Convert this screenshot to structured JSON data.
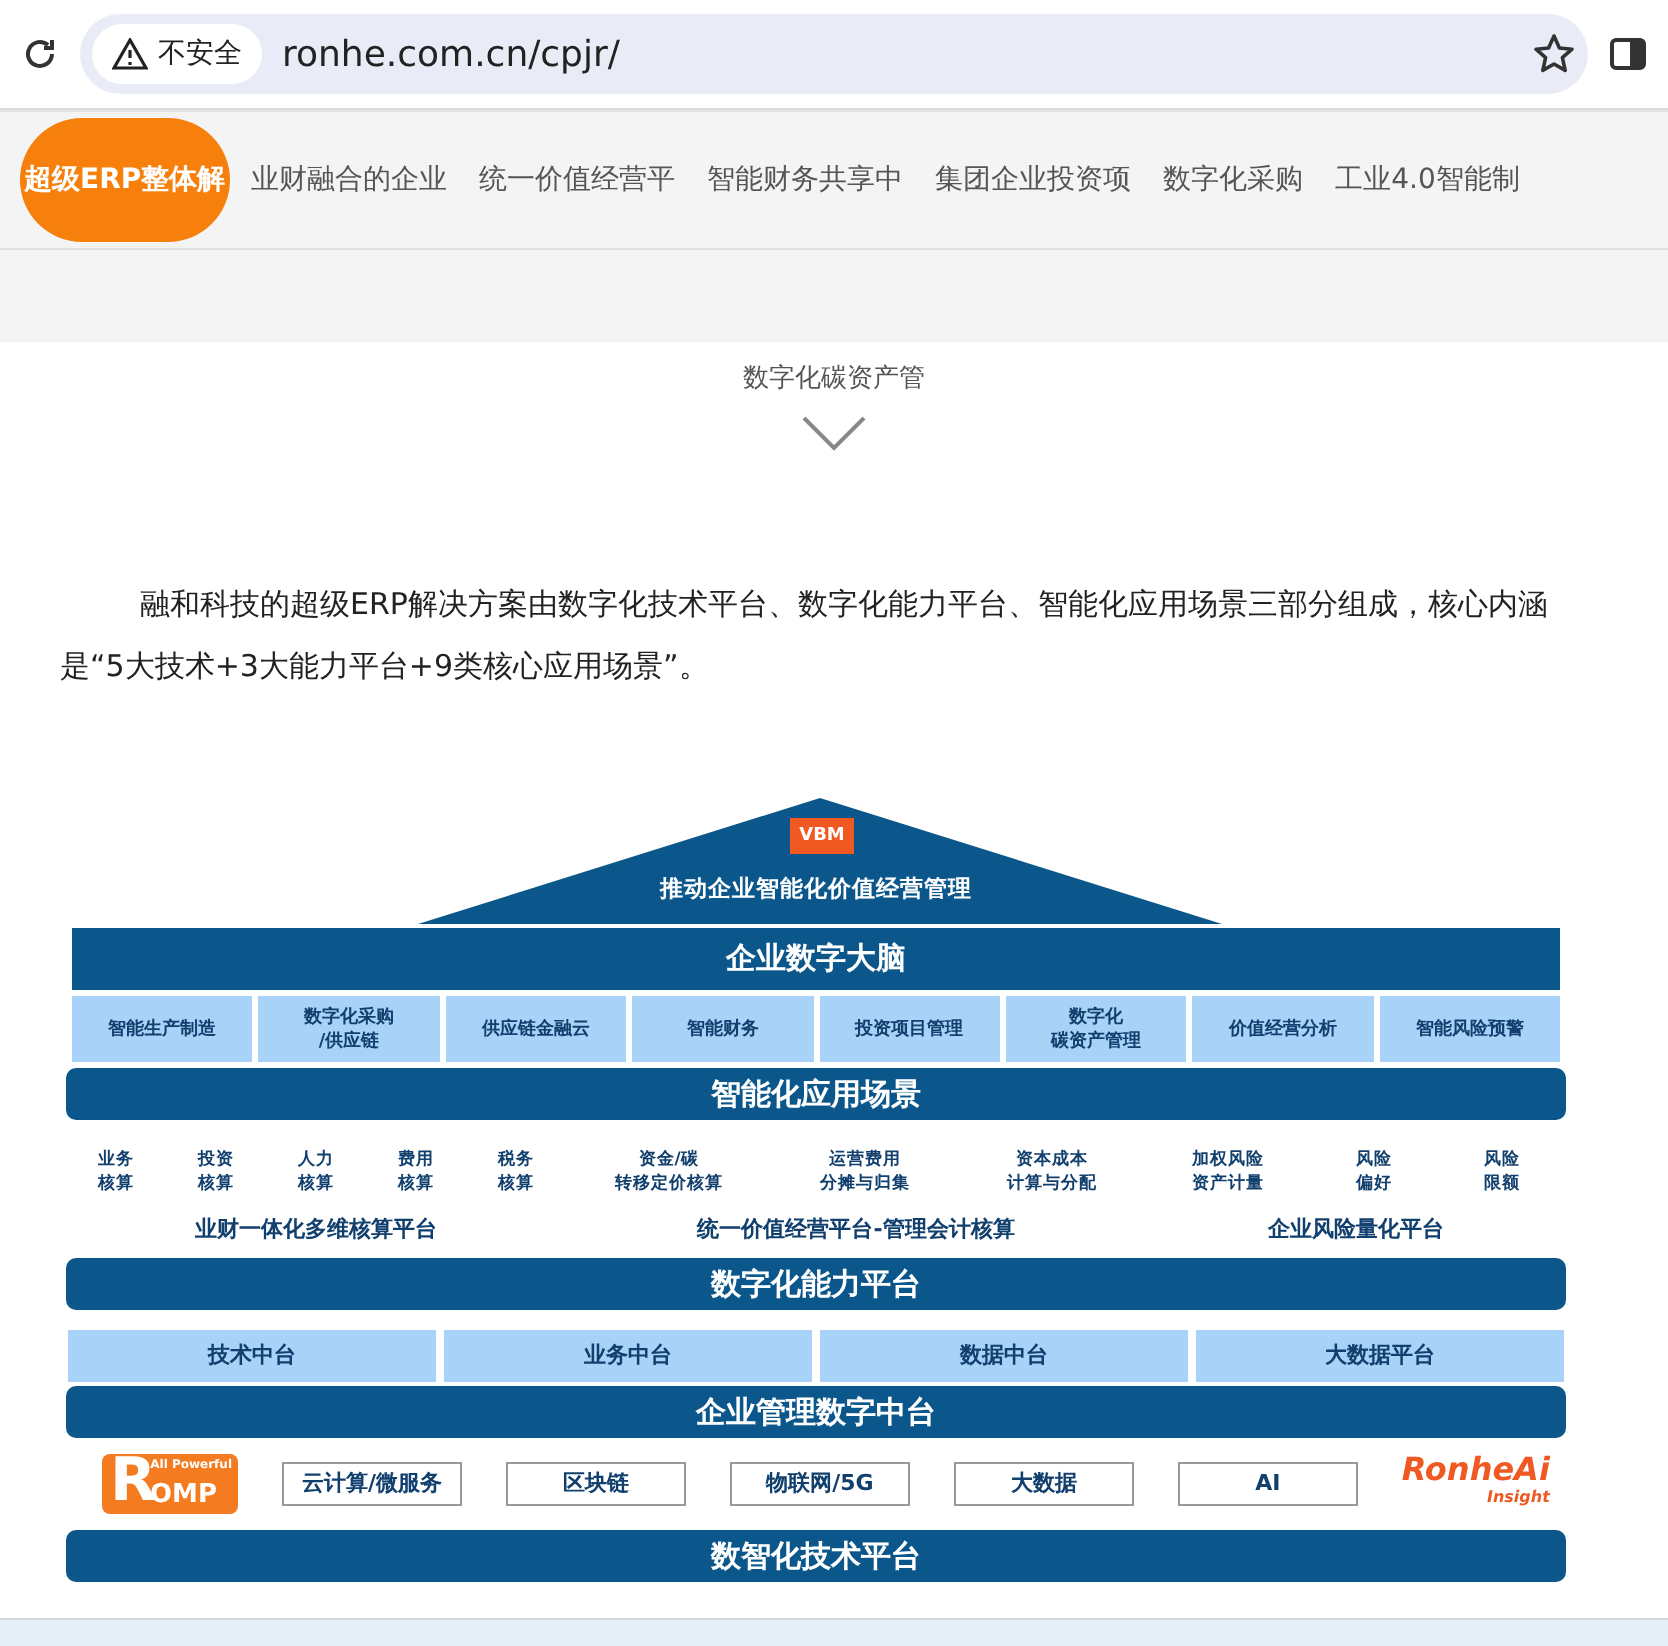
{
  "browser": {
    "security_label": "不安全",
    "url": "ronhe.com.cn/cpjr/"
  },
  "nav": {
    "items": [
      {
        "label": "超级ERP整体解",
        "selected": true
      },
      {
        "label": "业财融合的企业",
        "selected": false
      },
      {
        "label": "统一价值经营平",
        "selected": false
      },
      {
        "label": "智能财务共享中",
        "selected": false
      },
      {
        "label": "集团企业投资项",
        "selected": false
      },
      {
        "label": "数字化采购",
        "selected": false
      },
      {
        "label": "工业4.0智能制",
        "selected": false
      },
      {
        "label": "数字化碳资产管",
        "selected": false
      }
    ]
  },
  "intro": "融和科技的超级ERP解决方案由数字化技术平台、数字化能力平台、智能化应用场景三部分组成，核心内涵是“5大技术+3大能力平台+9类核心应用场景”。",
  "diagram": {
    "roof": {
      "logo": "VBM",
      "title": "推动企业智能化价值经营管理"
    },
    "brain_bar": "企业数字大脑",
    "scenarios": [
      {
        "lines": [
          "智能生产制造"
        ]
      },
      {
        "lines": [
          "数字化采购",
          "/供应链"
        ]
      },
      {
        "lines": [
          "供应链金融云"
        ]
      },
      {
        "lines": [
          "智能财务"
        ]
      },
      {
        "lines": [
          "投资项目管理"
        ]
      },
      {
        "lines": [
          "数字化",
          "碳资产管理"
        ]
      },
      {
        "lines": [
          "价值经营分析"
        ]
      },
      {
        "lines": [
          "智能风险预警"
        ]
      }
    ],
    "scenario_bar": "智能化应用场景",
    "platform_groups": [
      {
        "items": [
          {
            "lines": [
              "业务",
              "核算"
            ]
          },
          {
            "lines": [
              "投资",
              "核算"
            ]
          },
          {
            "lines": [
              "人力",
              "核算"
            ]
          },
          {
            "lines": [
              "费用",
              "核算"
            ]
          },
          {
            "lines": [
              "税务",
              "核算"
            ]
          }
        ],
        "label": "业财一体化多维核算平台"
      },
      {
        "items": [
          {
            "lines": [
              "资金/碳",
              "转移定价核算"
            ]
          },
          {
            "lines": [
              "运营费用",
              "分摊与归集"
            ]
          },
          {
            "lines": [
              "资本成本",
              "计算与分配"
            ]
          }
        ],
        "label": "统一价值经营平台-管理会计核算"
      },
      {
        "items": [
          {
            "lines": [
              "加权风险",
              "资产计量"
            ]
          },
          {
            "lines": [
              "风险",
              "偏好"
            ]
          },
          {
            "lines": [
              "风险",
              "限额"
            ]
          }
        ],
        "label": "企业风险量化平台"
      }
    ],
    "capability_bar": "数字化能力平台",
    "middle_platforms": [
      "技术中台",
      "业务中台",
      "数据中台",
      "大数据平台"
    ],
    "management_bar": "企业管理数字中台",
    "tech": {
      "left_logo": {
        "tagline": "All Powerful",
        "initial": "R",
        "rest": "OMP"
      },
      "items": [
        "云计算/微服务",
        "区块链",
        "物联网/5G",
        "大数据",
        "AI"
      ],
      "right_logo": {
        "name": "RonheAi",
        "tagline": "Insight"
      }
    },
    "tech_bar": "数智化技术平台"
  }
}
